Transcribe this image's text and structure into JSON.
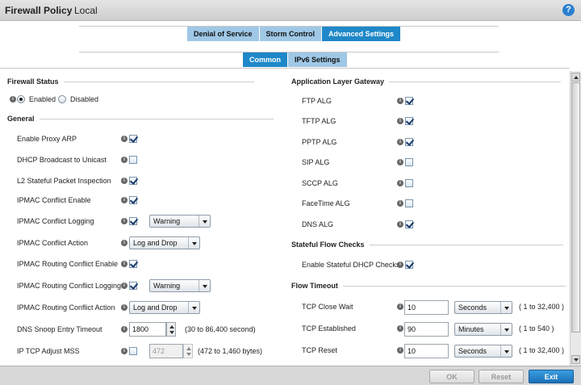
{
  "window": {
    "title": "Firewall Policy",
    "subtitle": "Local",
    "help_icon": "help-icon"
  },
  "tabs_top": [
    {
      "label": "Denial of Service",
      "active": false
    },
    {
      "label": "Storm Control",
      "active": false
    },
    {
      "label": "Advanced Settings",
      "active": true
    }
  ],
  "tabs_sub": [
    {
      "label": "Common",
      "active": true
    },
    {
      "label": "IPv6 Settings",
      "active": false
    }
  ],
  "firewall_status": {
    "heading": "Firewall Status",
    "enabled_label": "Enabled",
    "disabled_label": "Disabled",
    "selected": "Enabled"
  },
  "general": {
    "heading": "General",
    "rows": [
      {
        "label": "Enable Proxy ARP",
        "checked": true
      },
      {
        "label": "DHCP Broadcast to Unicast",
        "checked": false
      },
      {
        "label": "L2 Stateful Packet Inspection",
        "checked": true
      },
      {
        "label": "IPMAC Conflict Enable",
        "checked": true
      },
      {
        "label": "IPMAC Conflict Logging",
        "checked": true,
        "select": "Warning"
      },
      {
        "label": "IPMAC Conflict Action",
        "select": "Log and Drop"
      },
      {
        "label": "IPMAC Routing Conflict Enable",
        "checked": true
      },
      {
        "label": "IPMAC Routing Conflict Logging",
        "checked": true,
        "select": "Warning"
      },
      {
        "label": "IPMAC Routing Conflict Action",
        "select": "Log and Drop"
      },
      {
        "label": "DNS Snoop Entry Timeout",
        "value": "1800",
        "range": "(30 to 86,400 second)"
      },
      {
        "label": "IP TCP Adjust MSS",
        "checked": false,
        "value": "472",
        "range": "(472 to 1,460 bytes)"
      }
    ]
  },
  "alg": {
    "heading": "Application Layer Gateway",
    "rows": [
      {
        "label": "FTP ALG",
        "checked": true
      },
      {
        "label": "TFTP ALG",
        "checked": true
      },
      {
        "label": "PPTP ALG",
        "checked": true
      },
      {
        "label": "SIP ALG",
        "checked": false
      },
      {
        "label": "SCCP ALG",
        "checked": false
      },
      {
        "label": "FaceTime ALG",
        "checked": false
      },
      {
        "label": "DNS ALG",
        "checked": true
      }
    ]
  },
  "stateful": {
    "heading": "Stateful Flow Checks",
    "label": "Enable Stateful DHCP Checks",
    "checked": true
  },
  "flow_timeout": {
    "heading": "Flow Timeout",
    "rows": [
      {
        "label": "TCP Close Wait",
        "value": "10",
        "unit": "Seconds",
        "range": "( 1 to 32,400 )"
      },
      {
        "label": "TCP Established",
        "value": "90",
        "unit": "Minutes",
        "range": "( 1 to 540 )"
      },
      {
        "label": "TCP Reset",
        "value": "10",
        "unit": "Seconds",
        "range": "( 1 to 32,400 )"
      }
    ]
  },
  "footer": {
    "ok": "OK",
    "reset": "Reset",
    "exit": "Exit"
  }
}
